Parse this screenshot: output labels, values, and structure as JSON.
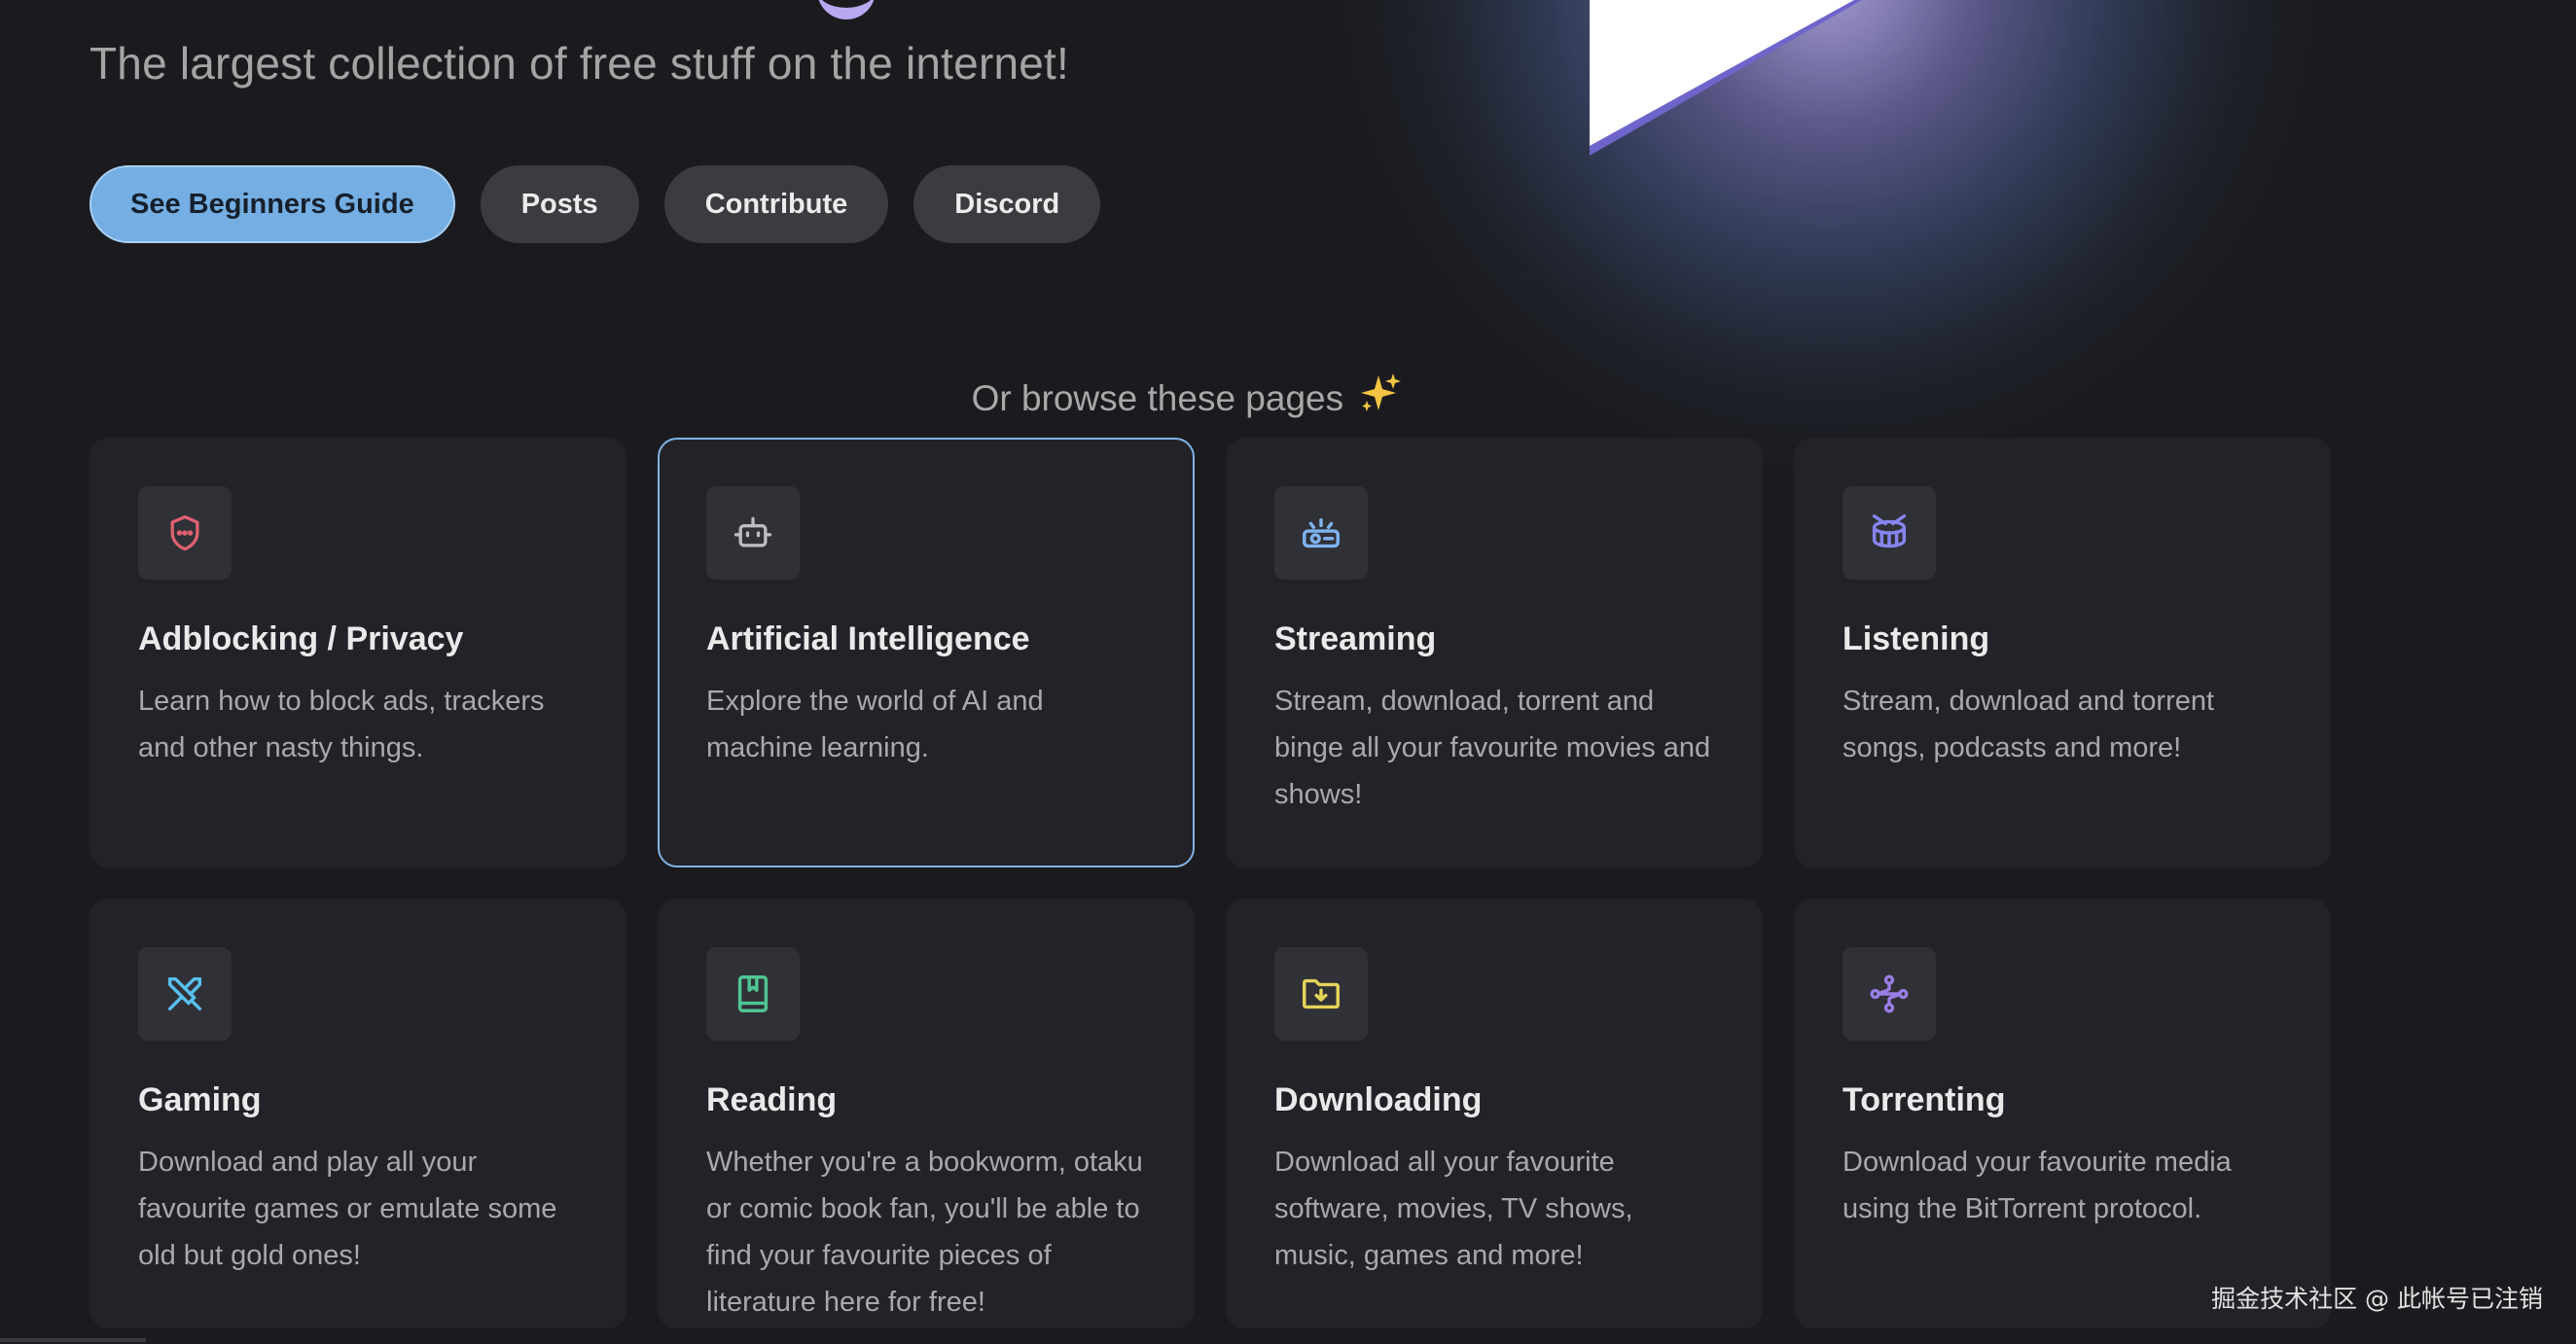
{
  "hero": {
    "tagline": "The largest collection of free stuff on the internet!"
  },
  "actions": [
    {
      "label": "See Beginners Guide"
    },
    {
      "label": "Posts"
    },
    {
      "label": "Contribute"
    },
    {
      "label": "Discord"
    }
  ],
  "browse_heading": "Or browse these pages",
  "cards": [
    {
      "title": "Adblocking / Privacy",
      "description": "Learn how to block ads, trackers and other nasty things.",
      "icon": "shield-icon",
      "color": "#e0616f"
    },
    {
      "title": "Artificial Intelligence",
      "description": "Explore the world of AI and machine learning.",
      "icon": "robot-icon",
      "color": "#bdbdc2"
    },
    {
      "title": "Streaming",
      "description": "Stream, download, torrent and binge all your favourite movies and shows!",
      "icon": "webcam-icon",
      "color": "#7fb3f0"
    },
    {
      "title": "Listening",
      "description": "Stream, download and torrent songs, podcasts and more!",
      "icon": "drum-icon",
      "color": "#8686f0"
    },
    {
      "title": "Gaming",
      "description": "Download and play all your favourite games or emulate some old but gold ones!",
      "icon": "swords-icon",
      "color": "#57c0ee"
    },
    {
      "title": "Reading",
      "description": "Whether you're a bookworm, otaku or comic book fan, you'll be able to find your favourite pieces of literature here for free!",
      "icon": "book-icon",
      "color": "#4fc593"
    },
    {
      "title": "Downloading",
      "description": "Download all your favourite software, movies, TV shows, music, games and more!",
      "icon": "folder-download-icon",
      "color": "#e6d45a"
    },
    {
      "title": "Torrenting",
      "description": "Download your favourite media using the BitTorrent protocol.",
      "icon": "network-icon",
      "color": "#9a7ee6"
    }
  ],
  "watermark": "掘金技术社区 @ 此帐号已注销"
}
